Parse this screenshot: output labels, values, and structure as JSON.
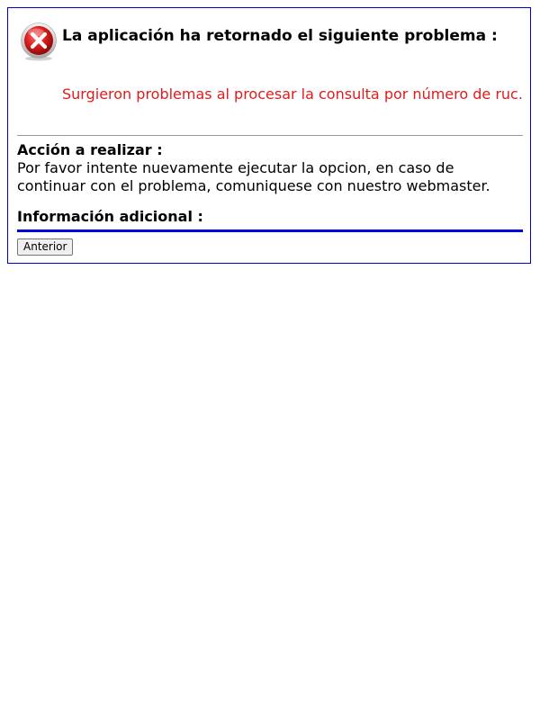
{
  "error": {
    "icon": "error-x-icon",
    "title": "La aplicación ha retornado el siguiente problema :",
    "message": "Surgieron problemas al procesar la consulta por número de ruc."
  },
  "action": {
    "title": "Acción a realizar :",
    "text": "Por favor intente nuevamente ejecutar la opcion, en caso de continuar con el problema, comuniquese con nuestro webmaster."
  },
  "info": {
    "title": "Información adicional :"
  },
  "buttons": {
    "back_label": "Anterior"
  },
  "colors": {
    "border": "#0000cc",
    "message": "#e01b1b",
    "separator": "#0000dd",
    "icon_red": "#d91c1c"
  }
}
